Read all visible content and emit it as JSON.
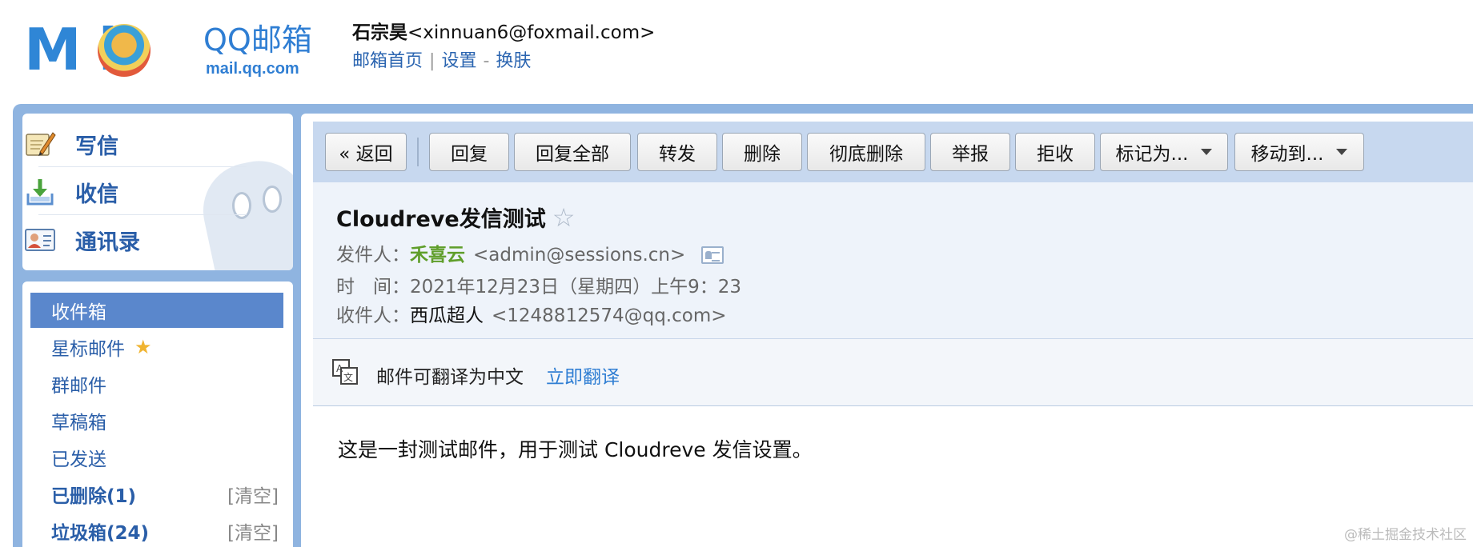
{
  "logo": {
    "mark_text": "M  il",
    "product": "QQ邮箱",
    "domain": "mail.qq.com"
  },
  "user": {
    "name": "石宗昊",
    "email": "<xinnuan6@foxmail.com>",
    "links": {
      "home": "邮箱首页",
      "divider": "|",
      "settings": "设置",
      "dash": "-",
      "skin": "换肤"
    }
  },
  "sidebar": {
    "nav": [
      {
        "label": "写信",
        "icon": "compose-icon"
      },
      {
        "label": "收信",
        "icon": "inbox-download-icon"
      },
      {
        "label": "通讯录",
        "icon": "contacts-icon"
      }
    ],
    "folders": [
      {
        "label": "收件箱",
        "active": true
      },
      {
        "label": "星标邮件",
        "star": "★"
      },
      {
        "label": "群邮件"
      },
      {
        "label": "草稿箱"
      },
      {
        "label": "已发送"
      },
      {
        "label": "已删除(1)",
        "bold": true,
        "action": "[清空]"
      },
      {
        "label": "垃圾箱(24)",
        "bold": true,
        "action": "[清空]"
      }
    ]
  },
  "toolbar": {
    "back": "« 返回",
    "reply": "回复",
    "reply_all": "回复全部",
    "forward": "转发",
    "delete": "删除",
    "delete_permanently": "彻底删除",
    "report": "举报",
    "reject": "拒收",
    "mark_as": "标记为...",
    "move_to": "移动到..."
  },
  "mail": {
    "subject": "Cloudreve发信测试",
    "star": "☆",
    "sender_label": "发件人：",
    "sender_name": "禾喜云",
    "sender_addr": "<admin@sessions.cn>",
    "time_label": "时　间：",
    "time_value": "2021年12月23日（星期四）上午9：23",
    "receiver_label": "收件人：",
    "receiver_name": "西瓜超人",
    "receiver_addr": "<1248812574@qq.com>",
    "translate_hint": "邮件可翻译为中文",
    "translate_link": "立即翻译",
    "body": "这是一封测试邮件，用于测试 Cloudreve 发信设置。"
  },
  "watermark": "@稀土掘金技术社区"
}
